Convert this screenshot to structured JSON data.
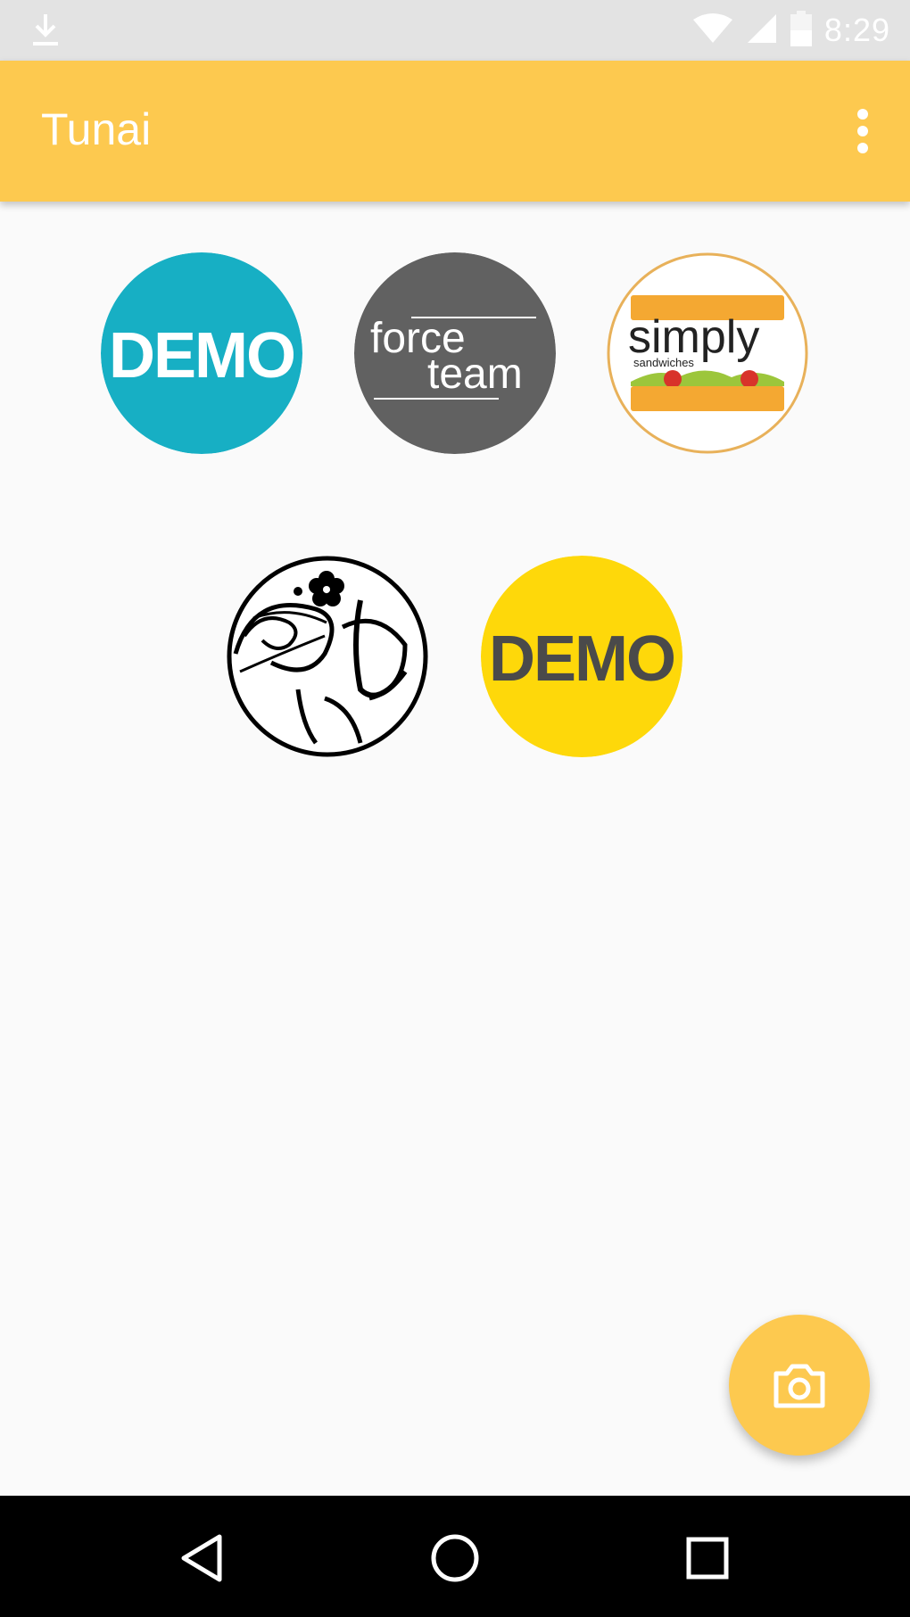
{
  "status_bar": {
    "time": "8:29",
    "icons": [
      "download-icon",
      "wifi-icon",
      "signal-icon",
      "battery-icon"
    ]
  },
  "app_bar": {
    "title": "Tunai",
    "menu_icon": "more-vertical-icon"
  },
  "merchants": [
    {
      "id": "demo-teal",
      "text": "DEMO",
      "bg": "#17afc4",
      "fg": "#ffffff"
    },
    {
      "id": "force-team",
      "line1": "force",
      "line2": "team",
      "bg": "#616161",
      "fg": "#ffffff"
    },
    {
      "id": "simply-sandwiches",
      "line1": "simply",
      "line2": "sandwiches",
      "bg": "#ffffff",
      "accent": "#f4a832"
    },
    {
      "id": "calligraphy",
      "bg": "#ffffff",
      "fg": "#000000"
    },
    {
      "id": "demo-yellow",
      "text": "DEMO",
      "bg": "#fed80a",
      "fg": "#4a4a4a"
    }
  ],
  "fab": {
    "icon": "camera-icon",
    "color": "#fdc94f"
  },
  "nav_bar": {
    "buttons": [
      "back-icon",
      "home-icon",
      "recents-icon"
    ]
  },
  "colors": {
    "accent": "#fdc94f",
    "background": "#fafafa"
  }
}
